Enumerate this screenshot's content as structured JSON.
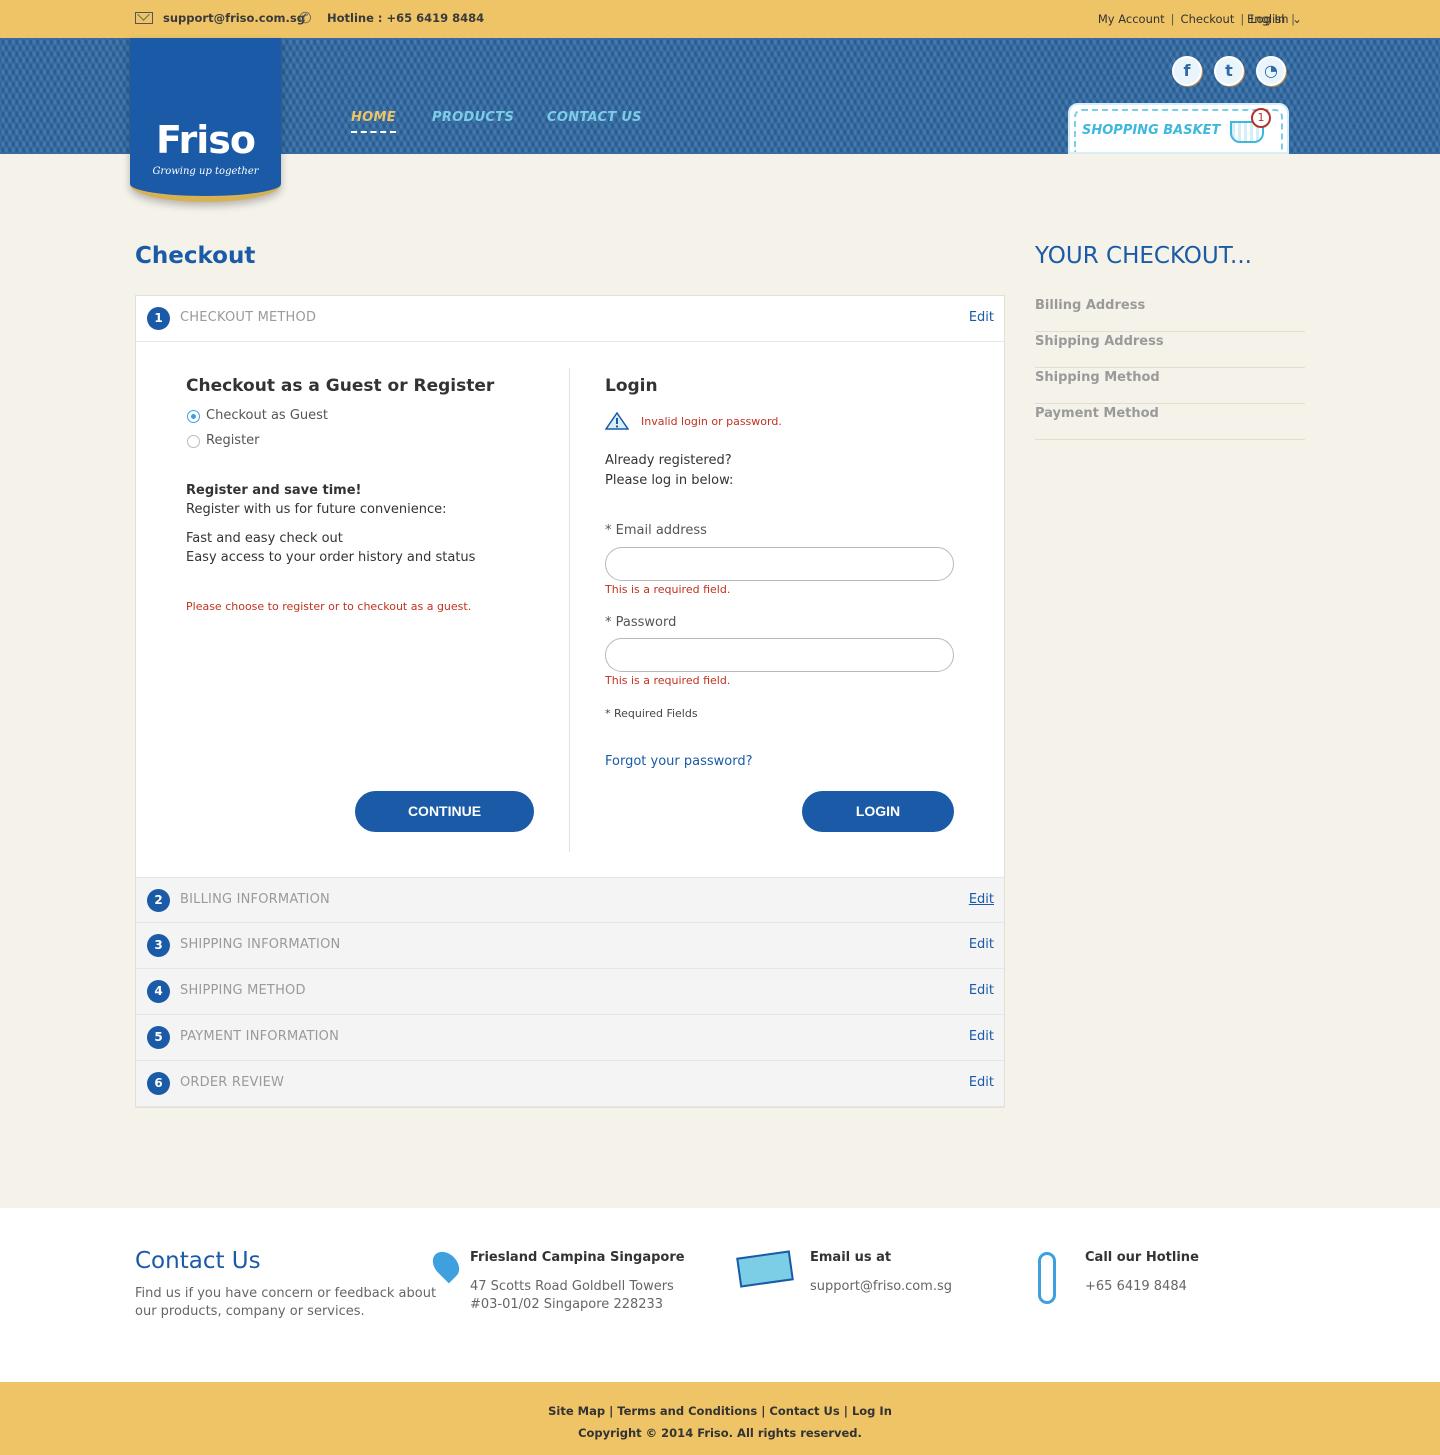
{
  "topbar": {
    "email": "support@friso.com.sg",
    "hotline": "Hotline : +65 6419 8484",
    "links": [
      "My Account",
      "Checkout",
      "Log In"
    ],
    "language": "English"
  },
  "brand": {
    "logo": "Friso",
    "tagline": "Growing up together"
  },
  "nav": {
    "items": [
      "HOME",
      "PRODUCTS",
      "CONTACT US"
    ]
  },
  "social": [
    "facebook-icon",
    "twitter-icon",
    "rss-icon"
  ],
  "basket": {
    "label": "SHOPPING BASKET",
    "count": "1"
  },
  "page": {
    "title": "Checkout"
  },
  "steps": [
    {
      "num": "1",
      "label": "CHECKOUT METHOD",
      "edit": "Edit"
    },
    {
      "num": "2",
      "label": "BILLING INFORMATION",
      "edit": "Edit"
    },
    {
      "num": "3",
      "label": "SHIPPING INFORMATION",
      "edit": "Edit"
    },
    {
      "num": "4",
      "label": "SHIPPING METHOD",
      "edit": "Edit"
    },
    {
      "num": "5",
      "label": "PAYMENT INFORMATION",
      "edit": "Edit"
    },
    {
      "num": "6",
      "label": "ORDER REVIEW",
      "edit": "Edit"
    }
  ],
  "guest": {
    "title": "Checkout as a Guest or Register",
    "option_guest": "Checkout as Guest",
    "option_register": "Register",
    "save_title": "Register and save time!",
    "save_sub": "Register with us for future convenience:",
    "benefit_1": "Fast and easy check out",
    "benefit_2": "Easy access to your order history and status",
    "error": "Please choose to register or to checkout as a guest.",
    "continue": "CONTINUE"
  },
  "login": {
    "title": "Login",
    "error": "Invalid login or password.",
    "already": "Already registered?",
    "please": "Please log in below:",
    "email_label": "* Email address",
    "email_value": "",
    "email_error": "This is a required field.",
    "password_label": "* Password",
    "password_value": "",
    "password_error": "This is a required field.",
    "required_note": "* Required Fields",
    "forgot": "Forgot your password?",
    "button": "LOGIN"
  },
  "sidebar": {
    "title": "YOUR CHECKOUT...",
    "items": [
      "Billing Address",
      "Shipping Address",
      "Shipping Method",
      "Payment Method"
    ]
  },
  "footer": {
    "contact_title": "Contact Us",
    "contact_text_1": "Find us if you have concern or feedback about",
    "contact_text_2": "our products, company or services.",
    "address_title": "Friesland Campina Singapore",
    "address_1": "47 Scotts Road Goldbell Towers",
    "address_2": "#03-01/02 Singapore 228233",
    "email_title": "Email us at",
    "email": "support@friso.com.sg",
    "hotline_title": "Call our Hotline",
    "hotline": "+65 6419 8484",
    "links": [
      "Site Map",
      "Terms and Conditions",
      "Contact Us",
      "Log In"
    ],
    "copyright": "Copyright © 2014 Friso. All rights reserved."
  },
  "colors": {
    "brand_blue": "#1a5aa6",
    "accent_yellow": "#eec466",
    "error_red": "#c0321f"
  }
}
